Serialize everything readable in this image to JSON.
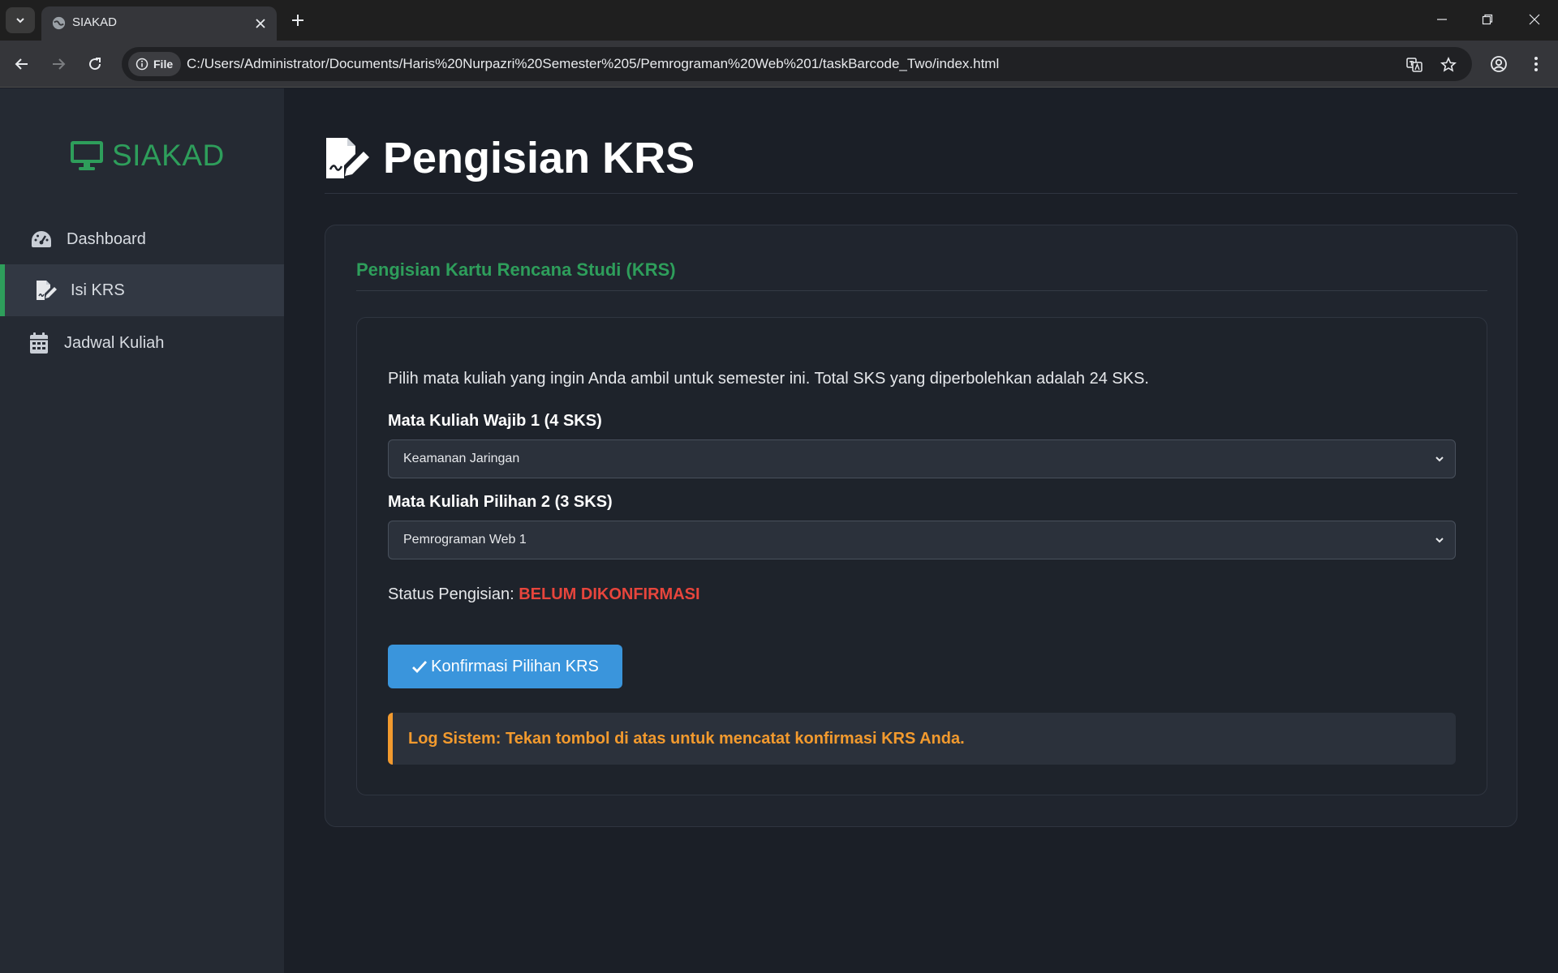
{
  "browser": {
    "tab_title": "SIAKAD",
    "security_chip": "File",
    "url": "C:/Users/Administrator/Documents/Haris%20Nurpazri%20Semester%205/Pemrograman%20Web%201/taskBarcode_Two/index.html"
  },
  "sidebar": {
    "brand": "SIAKAD",
    "items": [
      {
        "label": "Dashboard",
        "icon": "gauge-icon"
      },
      {
        "label": "Isi KRS",
        "icon": "file-signature-icon",
        "active": true
      },
      {
        "label": "Jadwal Kuliah",
        "icon": "calendar-icon"
      }
    ]
  },
  "main": {
    "page_title": "Pengisian KRS",
    "card_title": "Pengisian Kartu Rencana Studi (KRS)",
    "intro": "Pilih mata kuliah yang ingin Anda ambil untuk semester ini. Total SKS yang diperbolehkan adalah 24 SKS.",
    "fields": [
      {
        "label": "Mata Kuliah Wajib 1 (4 SKS)",
        "selected": "Keamanan Jaringan"
      },
      {
        "label": "Mata Kuliah Pilihan 2 (3 SKS)",
        "selected": "Pemrograman Web 1"
      }
    ],
    "status_label": "Status Pengisian:",
    "status_value": "BELUM DIKONFIRMASI",
    "confirm_button": "Konfirmasi Pilihan KRS",
    "log": "Log Sistem: Tekan tombol di atas untuk mencatat konfirmasi KRS Anda."
  },
  "colors": {
    "accent_green": "#2e9e5b",
    "button_blue": "#3a95dc",
    "status_red": "#e8453c",
    "log_orange": "#f29a2e"
  }
}
